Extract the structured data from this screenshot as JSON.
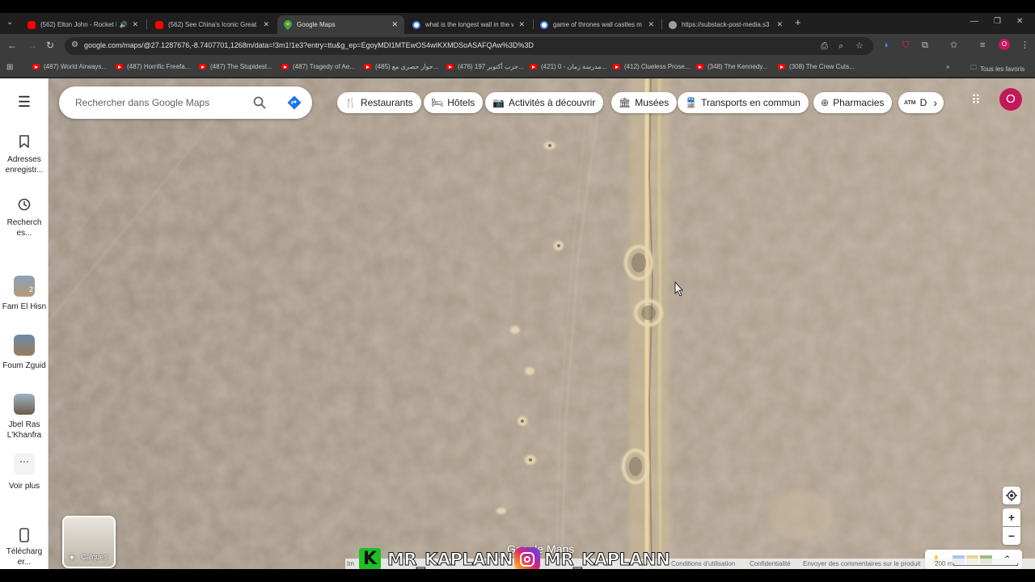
{
  "browser": {
    "tabs": [
      {
        "title": "(562) Elton John - Rocket M",
        "favicon_color": "#ff0000",
        "active": false
      },
      {
        "title": "(562) See China's Iconic Great W",
        "favicon_color": "#ff0000",
        "active": false
      },
      {
        "title": "Google Maps",
        "favicon_color": "#34a853",
        "active": true
      },
      {
        "title": "what is the longest wall in the w",
        "favicon_color": "#4285f4",
        "active": false
      },
      {
        "title": "game of thrones wall castles m",
        "favicon_color": "#4285f4",
        "active": false
      },
      {
        "title": "https://substack-post-media.s3",
        "favicon_color": "#9aa0a6",
        "active": false
      }
    ],
    "new_tab_label": "+",
    "url": "google.com/maps/@27.1287676,-8.7407701,1268m/data=!3m1!1e3?entry=ttu&g_ep=EgoyMDI1MTEwOS4wIKXMDSoASAFQAw%3D%3D",
    "profile_initial": "O",
    "bookmarks": [
      "(487) World Airways...",
      "(487) Horrific Freefa...",
      "(487) The Stupidest...",
      "(487) Tragedy of Ae...",
      "(485) حوار حصري مع...",
      "(476) حرب أكتوبر 197...",
      "(421) مدرسة زمان - 0...",
      "(412) Clueless Prose...",
      "(348) The Kennedy...",
      "(308) The Crew Cuts..."
    ],
    "all_bookmarks_label": "Tous les favoris"
  },
  "maps": {
    "search_placeholder": "Rechercher dans Google Maps",
    "rail": {
      "saved_label": "Adresses enregistr...",
      "recent_label": "Recherch es...",
      "recent_places": [
        {
          "label": "Fam El Hisn",
          "badge": "2"
        },
        {
          "label": "Foum Zguid",
          "badge": ""
        },
        {
          "label": "Jbel Ras L'Khanfra",
          "badge": ""
        }
      ],
      "more_label": "Voir plus",
      "download_label": "Télécharg er..."
    },
    "chips": [
      {
        "label": "Restaurants",
        "icon": "restaurant-icon"
      },
      {
        "label": "Hôtels",
        "icon": "hotel-icon"
      },
      {
        "label": "Activités à découvrir",
        "icon": "camera-icon"
      },
      {
        "label": "Musées",
        "icon": "museum-icon"
      },
      {
        "label": "Transports en commun",
        "icon": "transit-icon"
      },
      {
        "label": "Pharmacies",
        "icon": "pharmacy-icon"
      },
      {
        "label": "D",
        "icon": "atm-icon"
      }
    ],
    "layers_label": "Calques",
    "watermark_logo": "Google Maps",
    "attribution": {
      "imagery": "Im",
      "terms": "Conditions d'utilisation",
      "privacy": "Confidentialité",
      "feedback": "Envoyer des commentaires sur le produit",
      "scale": "200 m"
    }
  },
  "overlay": {
    "handle_1": "MR_KAPLANN",
    "handle_2": "MR_KAPLANN"
  },
  "colors": {
    "tab_bg": "#1f1f1f",
    "toolbar_bg": "#3c3c3c",
    "map_sand": "#a89a88",
    "wall": "#e6d4a6",
    "directions": "#1a73e8",
    "avatar": "#c2185b"
  }
}
